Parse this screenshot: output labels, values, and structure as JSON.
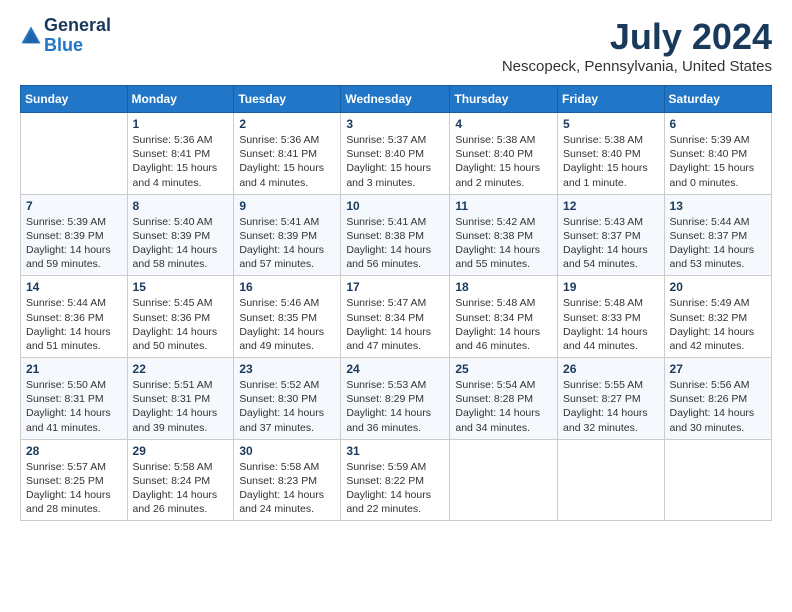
{
  "header": {
    "logo": {
      "general": "General",
      "blue": "Blue"
    },
    "title": "July 2024",
    "subtitle": "Nescopeck, Pennsylvania, United States"
  },
  "columns": [
    "Sunday",
    "Monday",
    "Tuesday",
    "Wednesday",
    "Thursday",
    "Friday",
    "Saturday"
  ],
  "weeks": [
    [
      {
        "day": "",
        "info": ""
      },
      {
        "day": "1",
        "info": "Sunrise: 5:36 AM\nSunset: 8:41 PM\nDaylight: 15 hours\nand 4 minutes."
      },
      {
        "day": "2",
        "info": "Sunrise: 5:36 AM\nSunset: 8:41 PM\nDaylight: 15 hours\nand 4 minutes."
      },
      {
        "day": "3",
        "info": "Sunrise: 5:37 AM\nSunset: 8:40 PM\nDaylight: 15 hours\nand 3 minutes."
      },
      {
        "day": "4",
        "info": "Sunrise: 5:38 AM\nSunset: 8:40 PM\nDaylight: 15 hours\nand 2 minutes."
      },
      {
        "day": "5",
        "info": "Sunrise: 5:38 AM\nSunset: 8:40 PM\nDaylight: 15 hours\nand 1 minute."
      },
      {
        "day": "6",
        "info": "Sunrise: 5:39 AM\nSunset: 8:40 PM\nDaylight: 15 hours\nand 0 minutes."
      }
    ],
    [
      {
        "day": "7",
        "info": "Sunrise: 5:39 AM\nSunset: 8:39 PM\nDaylight: 14 hours\nand 59 minutes."
      },
      {
        "day": "8",
        "info": "Sunrise: 5:40 AM\nSunset: 8:39 PM\nDaylight: 14 hours\nand 58 minutes."
      },
      {
        "day": "9",
        "info": "Sunrise: 5:41 AM\nSunset: 8:39 PM\nDaylight: 14 hours\nand 57 minutes."
      },
      {
        "day": "10",
        "info": "Sunrise: 5:41 AM\nSunset: 8:38 PM\nDaylight: 14 hours\nand 56 minutes."
      },
      {
        "day": "11",
        "info": "Sunrise: 5:42 AM\nSunset: 8:38 PM\nDaylight: 14 hours\nand 55 minutes."
      },
      {
        "day": "12",
        "info": "Sunrise: 5:43 AM\nSunset: 8:37 PM\nDaylight: 14 hours\nand 54 minutes."
      },
      {
        "day": "13",
        "info": "Sunrise: 5:44 AM\nSunset: 8:37 PM\nDaylight: 14 hours\nand 53 minutes."
      }
    ],
    [
      {
        "day": "14",
        "info": "Sunrise: 5:44 AM\nSunset: 8:36 PM\nDaylight: 14 hours\nand 51 minutes."
      },
      {
        "day": "15",
        "info": "Sunrise: 5:45 AM\nSunset: 8:36 PM\nDaylight: 14 hours\nand 50 minutes."
      },
      {
        "day": "16",
        "info": "Sunrise: 5:46 AM\nSunset: 8:35 PM\nDaylight: 14 hours\nand 49 minutes."
      },
      {
        "day": "17",
        "info": "Sunrise: 5:47 AM\nSunset: 8:34 PM\nDaylight: 14 hours\nand 47 minutes."
      },
      {
        "day": "18",
        "info": "Sunrise: 5:48 AM\nSunset: 8:34 PM\nDaylight: 14 hours\nand 46 minutes."
      },
      {
        "day": "19",
        "info": "Sunrise: 5:48 AM\nSunset: 8:33 PM\nDaylight: 14 hours\nand 44 minutes."
      },
      {
        "day": "20",
        "info": "Sunrise: 5:49 AM\nSunset: 8:32 PM\nDaylight: 14 hours\nand 42 minutes."
      }
    ],
    [
      {
        "day": "21",
        "info": "Sunrise: 5:50 AM\nSunset: 8:31 PM\nDaylight: 14 hours\nand 41 minutes."
      },
      {
        "day": "22",
        "info": "Sunrise: 5:51 AM\nSunset: 8:31 PM\nDaylight: 14 hours\nand 39 minutes."
      },
      {
        "day": "23",
        "info": "Sunrise: 5:52 AM\nSunset: 8:30 PM\nDaylight: 14 hours\nand 37 minutes."
      },
      {
        "day": "24",
        "info": "Sunrise: 5:53 AM\nSunset: 8:29 PM\nDaylight: 14 hours\nand 36 minutes."
      },
      {
        "day": "25",
        "info": "Sunrise: 5:54 AM\nSunset: 8:28 PM\nDaylight: 14 hours\nand 34 minutes."
      },
      {
        "day": "26",
        "info": "Sunrise: 5:55 AM\nSunset: 8:27 PM\nDaylight: 14 hours\nand 32 minutes."
      },
      {
        "day": "27",
        "info": "Sunrise: 5:56 AM\nSunset: 8:26 PM\nDaylight: 14 hours\nand 30 minutes."
      }
    ],
    [
      {
        "day": "28",
        "info": "Sunrise: 5:57 AM\nSunset: 8:25 PM\nDaylight: 14 hours\nand 28 minutes."
      },
      {
        "day": "29",
        "info": "Sunrise: 5:58 AM\nSunset: 8:24 PM\nDaylight: 14 hours\nand 26 minutes."
      },
      {
        "day": "30",
        "info": "Sunrise: 5:58 AM\nSunset: 8:23 PM\nDaylight: 14 hours\nand 24 minutes."
      },
      {
        "day": "31",
        "info": "Sunrise: 5:59 AM\nSunset: 8:22 PM\nDaylight: 14 hours\nand 22 minutes."
      },
      {
        "day": "",
        "info": ""
      },
      {
        "day": "",
        "info": ""
      },
      {
        "day": "",
        "info": ""
      }
    ]
  ]
}
